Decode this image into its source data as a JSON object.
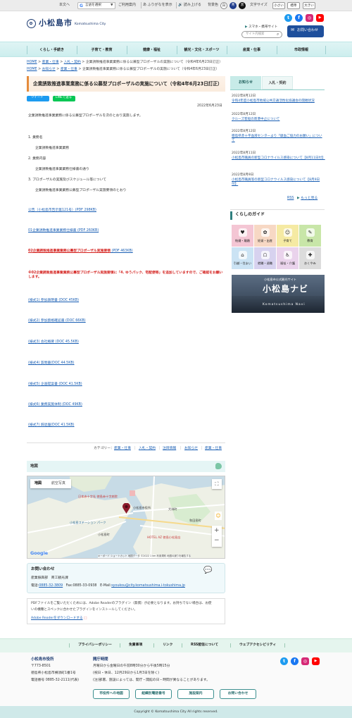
{
  "utility": {
    "home": "本文へ",
    "translate": "言語を選択",
    "translate_caret": "▼",
    "usage": "ご利用案内",
    "furigana": "ふりがなを表示",
    "readaloud": "読み上げる",
    "bg_label": "背景色",
    "bg_white": "白",
    "bg_blue": "青",
    "bg_black": "黒",
    "text_label": "文字サイズ",
    "size_small": "小さい",
    "size_normal": "標準",
    "size_large": "大きい"
  },
  "header": {
    "logo": "小松島市",
    "logo_en": "Komatsushima City",
    "mobile_link": "スマホ・携帯サイト",
    "search_placeholder": "サイト内検索",
    "contact_btn": "お問い合わせ",
    "sns": [
      "t",
      "f",
      "◎",
      "▶"
    ]
  },
  "gnav": [
    "くらし・手続き",
    "子育て・教育",
    "健康・福祉",
    "観光・文化・スポーツ",
    "産業・仕事",
    "市政情報"
  ],
  "breadcrumbs": [
    [
      "HOME",
      "産業・仕事",
      "入札・契約",
      "企業誘致推進事業業務に係る公募型プロポーザルの実施について（令和4年6月23日訂正）"
    ],
    [
      "HOME",
      "お知らせ",
      "産業・仕事",
      "企業誘致推進事業業務に係る公募型プロポーザルの実施について（令和4年6月23日訂正）"
    ]
  ],
  "crumb_sep": ">",
  "page": {
    "title": "企業誘致推進事業業務に係る公募型プロポーザルの実施について（令和4年6月23日訂正）",
    "share_tweet": "ツイート",
    "share_line": "LINEで送る",
    "date": "2022年6月23日",
    "intro": "企業誘致推進事業業務に係る公募型プロポーザルを次のとおり実施します。",
    "sections": [
      {
        "label": "1. 業務名",
        "value": "企業誘致推進事業業務"
      },
      {
        "label": "2. 業務内容",
        "value": "企業誘致推進事業業務仕様書の通り"
      },
      {
        "label": "3. プロポーザルの実施及びスケジュール等について",
        "value": "企業誘致推進事業業務公募型プロポーザル実施要領のとおり"
      }
    ],
    "links": [
      {
        "text": "公告（小松島市告示第121号）(PDF 298KB)",
        "style": "normal"
      },
      {
        "text": "01企業誘致推進事業業務仕様書 (PDF 260KB)",
        "style": "normal"
      },
      {
        "text": "02企業誘致推進事業業務公募型プロポーザル実施要領",
        "suffix": " (PDF 463KB)",
        "style": "red"
      },
      {
        "text": "※02企業誘致推進事業業務公募型プロポーザル実施要領に「4. ゆうパック、宅配便等」を追加していますので、ご確認をお願いします。",
        "style": "notice"
      },
      {
        "text": "(様式1) 参加表明書 (DOC 45KB)",
        "style": "normal"
      },
      {
        "text": "(様式2) 参加資格確認書 (DOC 66KB)",
        "style": "normal"
      },
      {
        "text": "(様式3) 会社概要 (DOC 45.5KB)",
        "style": "normal"
      },
      {
        "text": "(様式4) 質問書(DOC 44.5KB)",
        "style": "normal"
      },
      {
        "text": "(様式5) 企画提案書 (DOC 41.5KB)",
        "style": "normal"
      },
      {
        "text": "(様式6) 業務実施体制 (DOC 49KB)",
        "style": "normal"
      },
      {
        "text": "(様式7) 辞退届(DOC 41.5KB)",
        "style": "normal"
      }
    ],
    "category_label": "カテゴリー：",
    "categories": [
      "産業・仕事",
      "入札・契約",
      "注目情報",
      "お知らせ",
      "産業・仕事"
    ]
  },
  "map": {
    "header": "地図",
    "tab_map": "地図",
    "tab_sat": "航空写真",
    "labels": [
      "日本赤十字社 徳島赤十字病院",
      "小松島市役所",
      "小松島ステーション パーク",
      "HOTEL AZ 徳島小松島店",
      "大林町",
      "和田島町",
      "小松島町"
    ],
    "google": "Google",
    "attribution": "キーボード ショートカット   地図データ ©2022   1 km   利用規約   地図の誤りを報告する",
    "zoom_in": "+",
    "zoom_out": "−"
  },
  "contact": {
    "title": "お問い合わせ",
    "dept": "産業振興部　商工観光課",
    "phone_label": "電話:",
    "phone": "0885-32-3809",
    "fax": "Fax:0885-33-0938",
    "email_label": "E-Mail:",
    "email": "syoukou@city.komatsushima.i-tokushima.jp"
  },
  "pdf_notice": {
    "text1": "PDFファイルをご覧いただくためには、Adobe Readerのプラグイン（無償）が必要となります。お持ちでない場合は、お使",
    "text2": "いの機種とスペックに合わせたプラグインをインストールしてください。",
    "link": "Adobe Readerをダウンロードする"
  },
  "sidebar": {
    "tab_news": "お知らせ",
    "tab_bid": "入札・契約",
    "news": [
      {
        "date": "2022年8月12日",
        "text": "令和4年度小松島市地域公共交通活性化協議会の開催状況"
      },
      {
        "date": "2022年8月12日",
        "text": "クルーズ客船の寄港中止について"
      },
      {
        "date": "2022年8月12日",
        "text": "徳島県赤十字血液センターより「献血ご協力のお願い」について"
      },
      {
        "date": "2022年8月11日",
        "text": "小松島市職員の新型コロナウイルス感染について【8月11日付】"
      },
      {
        "date": "2022年8月9日",
        "text": "小松島市職員等の新型コロナウイルス感染について【8月9日付】"
      }
    ],
    "rss": "RSS",
    "more": "もっと見る",
    "guide_title": "くらしのガイド",
    "guide": [
      {
        "label": "結婚・離婚",
        "icon": "♥",
        "color": "#f4c6d4"
      },
      {
        "label": "妊娠・出産",
        "icon": "✿",
        "color": "#f7d8c4"
      },
      {
        "label": "子育て",
        "icon": "☺",
        "color": "#f5eaa3"
      },
      {
        "label": "教育",
        "icon": "✎",
        "color": "#c8e6a8"
      },
      {
        "label": "引越・住まい",
        "icon": "⌂",
        "color": "#cbe3f4"
      },
      {
        "label": "就職・退職",
        "icon": "☖",
        "color": "#d7d2ef"
      },
      {
        "label": "福祉・介護",
        "icon": "♿",
        "color": "#ead3ec"
      },
      {
        "label": "おくやみ",
        "icon": "✚",
        "color": "#dcdcdc"
      }
    ],
    "banner_small": "小松島市公式観光サイト",
    "banner_main": "小松島ナビ",
    "banner_en": "Komatsushima Navi"
  },
  "footer": {
    "links": [
      "プライバシーポリシー",
      "免責事項",
      "リンク",
      "RSS配信について",
      "ウェブアクセシビリティ"
    ],
    "org": "小松島市役所",
    "postal": "〒773-8501",
    "address": "徳島県小松島市横須町1番1号",
    "tel": "電話番号 0885-32-2111(代表)",
    "hours_title": "開庁時間",
    "hours1": "月曜日から金曜日の午前8時30分から午後5時15分",
    "hours2": "(祝日・休日、12月29日から1月3日を除く)",
    "hours3": "(注)部署、施設によっては、開庁・開館の日・時間が異なることがあります。",
    "buttons": [
      "市役所への地図",
      "組織別電話番号",
      "施設案内",
      "お問い合わせ"
    ],
    "copyright": "Copyright © Komatsushima City All rights reserved."
  },
  "colors": {
    "twitter": "#1d9bf0",
    "facebook": "#1877f2",
    "instagram": "#d62976",
    "youtube": "#ff0000",
    "accent": "#2f7f7f"
  }
}
